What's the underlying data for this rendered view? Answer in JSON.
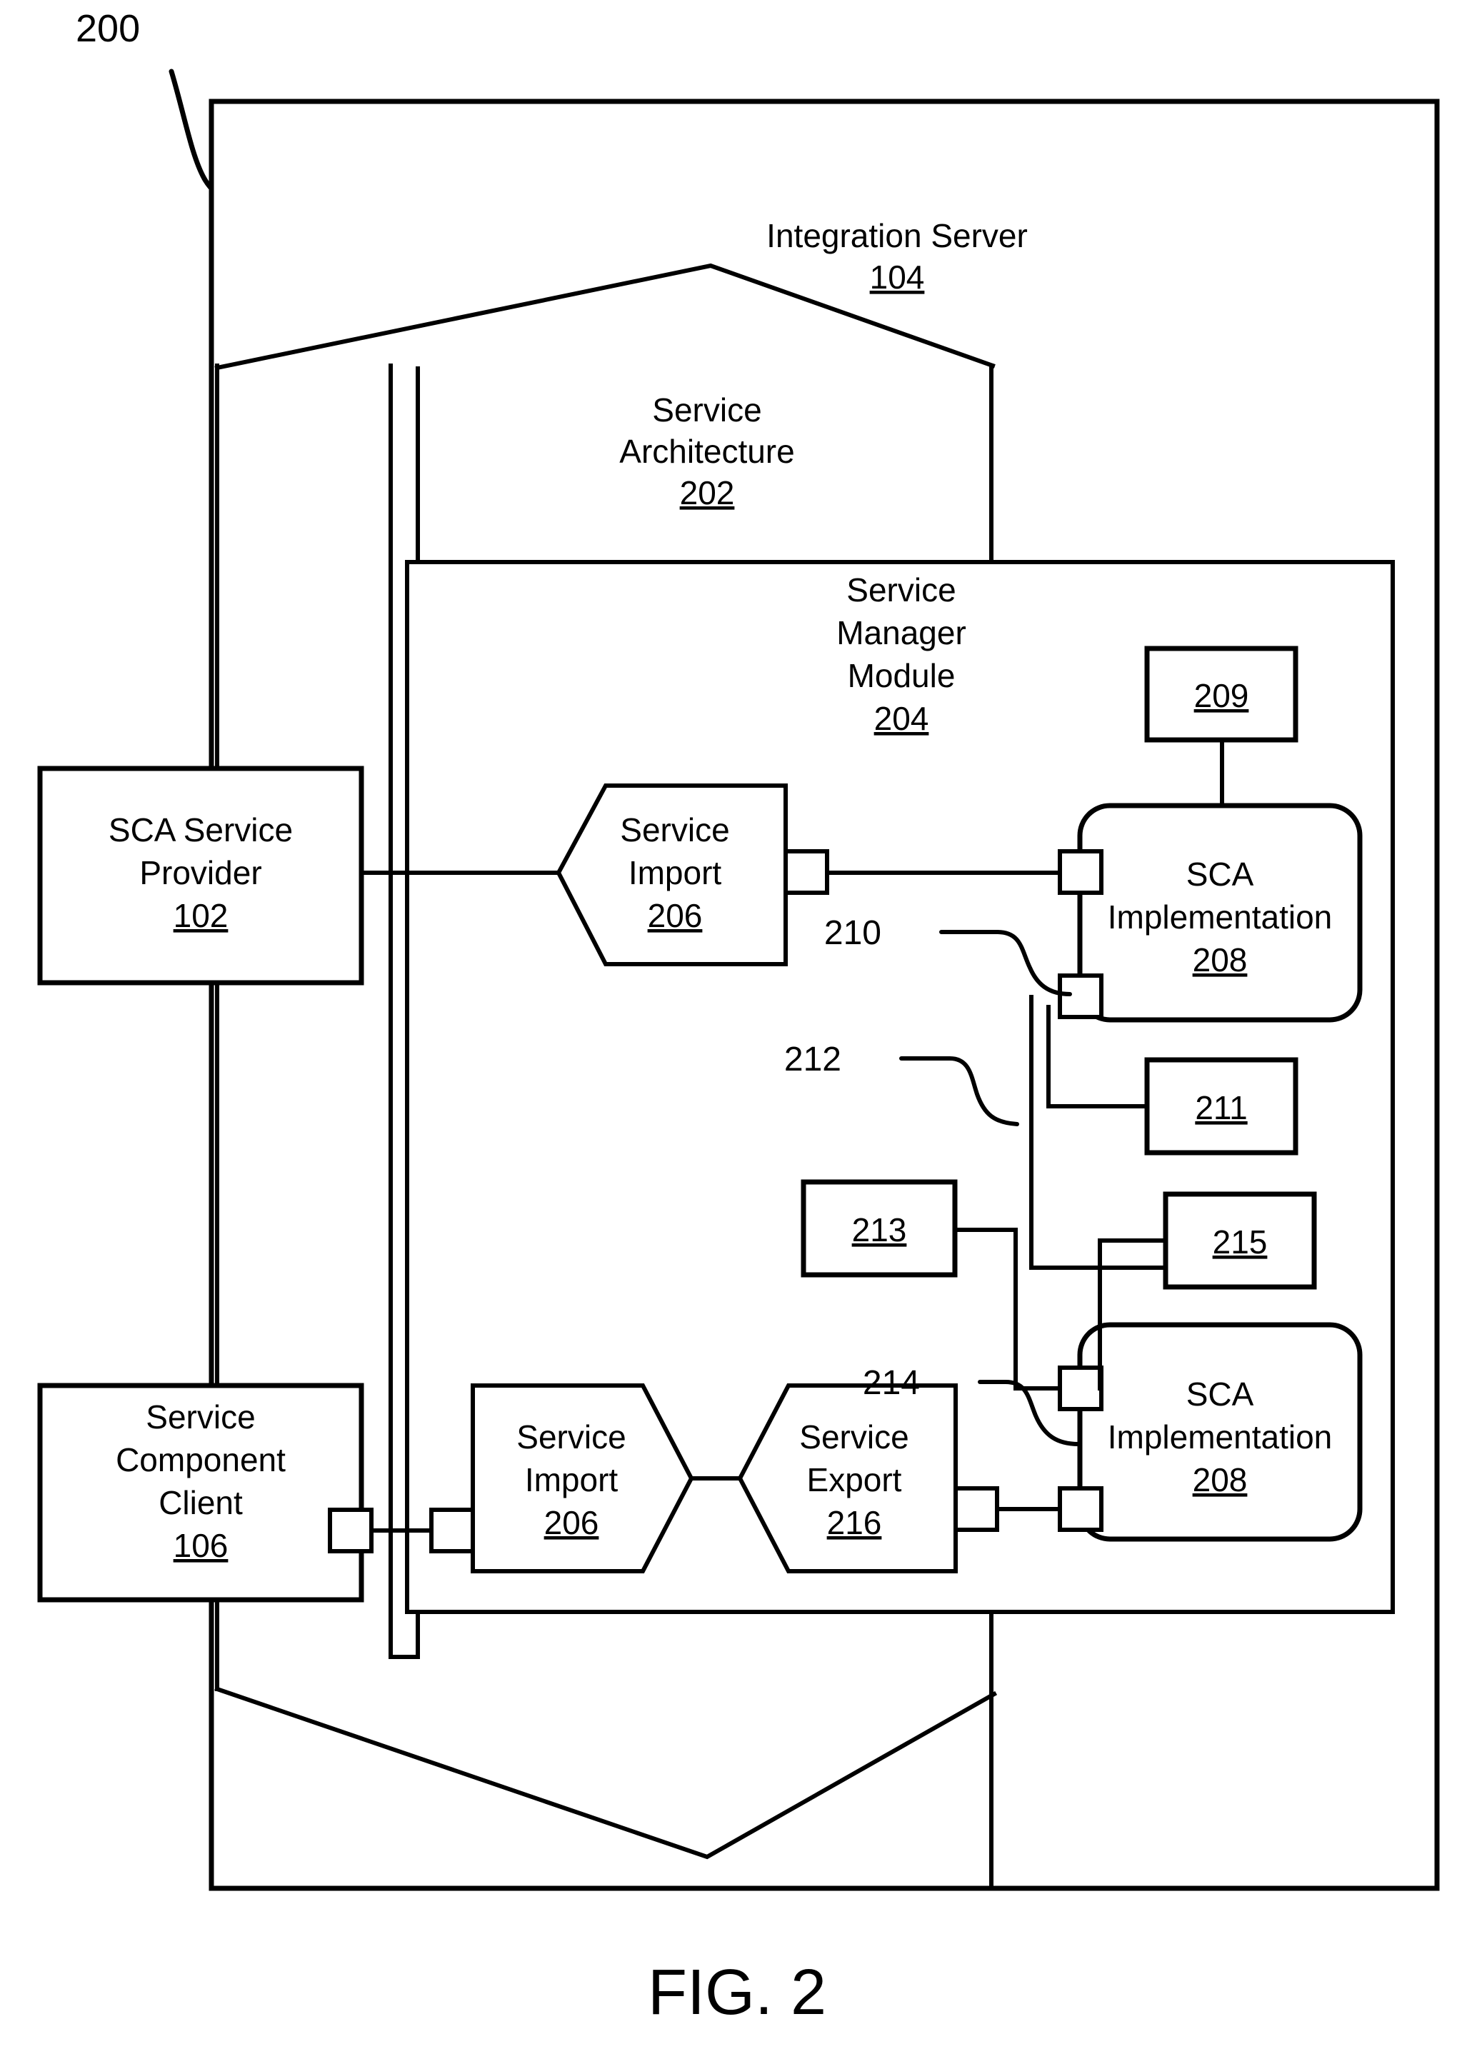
{
  "figure": {
    "tag": "200",
    "caption": "FIG. 2"
  },
  "outer": {
    "title": "Integration Server",
    "ref": "104"
  },
  "architecture": {
    "title_line1": "Service",
    "title_line2": "Architecture",
    "ref": "202"
  },
  "manager": {
    "title_line1": "Service",
    "title_line2": "Manager",
    "title_line3": "Module",
    "ref": "204"
  },
  "provider": {
    "title_line1": "SCA Service",
    "title_line2": "Provider",
    "ref": "102"
  },
  "client": {
    "title_line1": "Service",
    "title_line2": "Component",
    "title_line3": "Client",
    "ref": "106"
  },
  "import_top": {
    "title_line1": "Service",
    "title_line2": "Import",
    "ref": "206"
  },
  "import_bottom": {
    "title_line1": "Service",
    "title_line2": "Import",
    "ref": "206"
  },
  "export_bottom": {
    "title_line1": "Service",
    "title_line2": "Export",
    "ref": "216"
  },
  "impl_top": {
    "title_line1": "SCA",
    "title_line2": "Implementation",
    "ref": "208"
  },
  "impl_bottom": {
    "title_line1": "SCA",
    "title_line2": "Implementation",
    "ref": "208"
  },
  "artifacts": {
    "box_209": "209",
    "box_211": "211",
    "box_213": "213",
    "box_215": "215"
  },
  "leaders": {
    "wire_210": "210",
    "wire_212": "212",
    "wire_214": "214"
  },
  "colors": {
    "ink": "#000000",
    "paper": "#ffffff"
  }
}
